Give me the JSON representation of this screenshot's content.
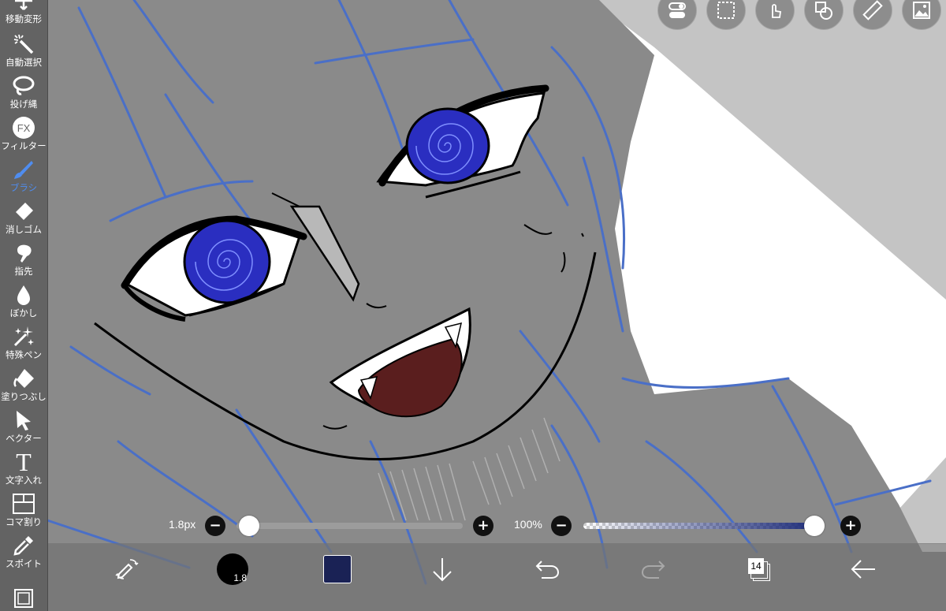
{
  "left_toolbar": {
    "tools": [
      {
        "id": "transform",
        "label": "移動変形",
        "icon": "move-transform-icon"
      },
      {
        "id": "magic-wand",
        "label": "自動選択",
        "icon": "magic-wand-icon"
      },
      {
        "id": "lasso",
        "label": "投げ縄",
        "icon": "lasso-icon"
      },
      {
        "id": "filter",
        "label": "フィルター",
        "icon": "fx-icon",
        "icon_text": "FX"
      },
      {
        "id": "brush",
        "label": "ブラシ",
        "icon": "brush-icon",
        "active": true
      },
      {
        "id": "eraser",
        "label": "消しゴム",
        "icon": "eraser-icon"
      },
      {
        "id": "smudge",
        "label": "指先",
        "icon": "smudge-icon"
      },
      {
        "id": "blur",
        "label": "ぼかし",
        "icon": "blur-drop-icon"
      },
      {
        "id": "special-pen",
        "label": "特殊ペン",
        "icon": "sparkle-pen-icon"
      },
      {
        "id": "fill",
        "label": "塗りつぶし",
        "icon": "fill-bucket-icon"
      },
      {
        "id": "vector",
        "label": "ベクター",
        "icon": "vector-cursor-icon"
      },
      {
        "id": "text",
        "label": "文字入れ",
        "icon": "text-icon",
        "icon_text": "T"
      },
      {
        "id": "frame",
        "label": "コマ割り",
        "icon": "frame-divider-icon"
      },
      {
        "id": "eyedropper",
        "label": "スポイト",
        "icon": "eyedropper-icon"
      },
      {
        "id": "canvas",
        "label": "",
        "icon": "canvas-frame-icon"
      }
    ],
    "active_color": "#4f8df0"
  },
  "top_toolbar": {
    "buttons": [
      {
        "id": "toggle",
        "icon": "toggle-switch-icon"
      },
      {
        "id": "selection",
        "icon": "dashed-selection-icon"
      },
      {
        "id": "touch",
        "icon": "touch-gesture-icon"
      },
      {
        "id": "shape",
        "icon": "shape-icon"
      },
      {
        "id": "ruler",
        "icon": "ruler-icon"
      },
      {
        "id": "material",
        "icon": "image-material-icon"
      }
    ]
  },
  "brush_size_slider": {
    "label": "1.8px",
    "minus": "−",
    "plus": "+",
    "value_fraction": 0.02
  },
  "opacity_slider": {
    "label": "100%",
    "minus": "−",
    "plus": "+",
    "value_fraction": 1.0,
    "color": "#1b2a78"
  },
  "bottom_toolbar": {
    "brush_size_value": "1.8",
    "current_color": "#1a2255",
    "layer_count": "14",
    "buttons": [
      {
        "id": "quick-menu",
        "icon": "edit-swap-icon"
      },
      {
        "id": "brush-size",
        "icon": "brush-size-circle-icon"
      },
      {
        "id": "color",
        "icon": "color-swatch-icon"
      },
      {
        "id": "download",
        "icon": "down-arrow-icon"
      },
      {
        "id": "undo",
        "icon": "undo-icon"
      },
      {
        "id": "redo",
        "icon": "redo-icon"
      },
      {
        "id": "layers",
        "icon": "layers-icon"
      },
      {
        "id": "back",
        "icon": "back-arrow-icon"
      }
    ]
  },
  "colors": {
    "sketch_line": "#4a6fc7",
    "eye_iris": "#2a2ec0",
    "tongue": "#5a1e1e",
    "skin_gray": "#8a8a8a",
    "background_white": "#ffffff"
  }
}
